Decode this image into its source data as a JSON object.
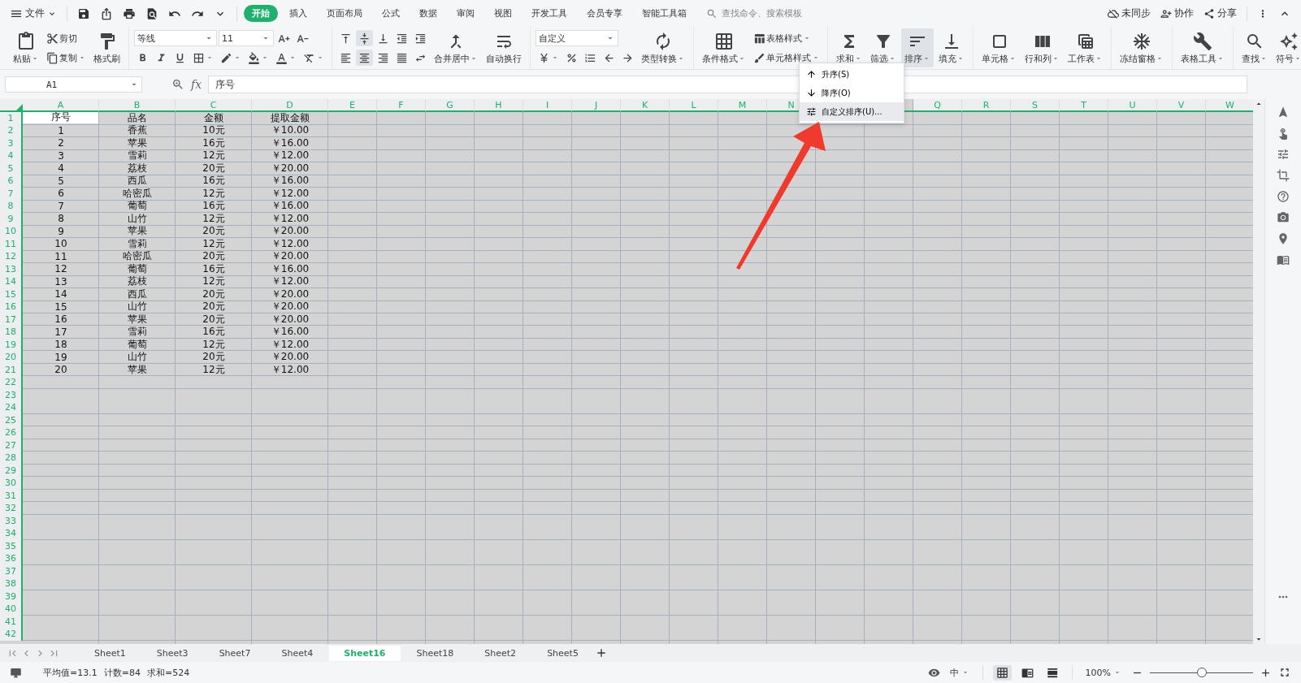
{
  "title_bar": {
    "file_menu": "文件",
    "menu_tabs": [
      {
        "label": "开始",
        "selected": true
      },
      {
        "label": "插入",
        "selected": false
      },
      {
        "label": "页面布局",
        "selected": false
      },
      {
        "label": "公式",
        "selected": false
      },
      {
        "label": "数据",
        "selected": false
      },
      {
        "label": "审阅",
        "selected": false
      },
      {
        "label": "视图",
        "selected": false
      },
      {
        "label": "开发工具",
        "selected": false
      },
      {
        "label": "会员专享",
        "selected": false
      },
      {
        "label": "智能工具箱",
        "selected": false
      }
    ],
    "search": {
      "placeholder": "查找命令、搜索模板"
    },
    "actions": [
      "未同步",
      "协作",
      "分享"
    ]
  },
  "ribbon": {
    "groups": [
      {
        "blocks": [
          {
            "kind": "large",
            "label": "粘贴",
            "dropdown": true
          },
          {
            "kind": "stack",
            "rows": [
              [
                {
                  "kind": "small",
                  "label": "剪切",
                  "dropdown": false
                }
              ],
              [
                {
                  "kind": "small",
                  "label": "复制",
                  "dropdown": true
                }
              ]
            ]
          },
          {
            "kind": "large",
            "label": "格式刷",
            "dropdown": false
          }
        ]
      },
      {
        "blocks": [
          {
            "kind": "stack",
            "rows": [
              [
                {
                  "kind": "select",
                  "label": "等线",
                  "wide": true
                },
                {
                  "kind": "select",
                  "label": "11",
                  "wide": false
                },
                {
                  "kind": "icon",
                  "dropdown": false
                },
                {
                  "kind": "icon",
                  "dropdown": false
                }
              ],
              [
                {
                  "kind": "icon",
                  "dropdown": false
                },
                {
                  "kind": "icon",
                  "dropdown": false
                },
                {
                  "kind": "icon",
                  "dropdown": false
                },
                {
                  "kind": "icon",
                  "dropdown": true
                },
                {
                  "kind": "icon",
                  "dropdown": true
                },
                {
                  "kind": "icon",
                  "dropdown": true
                },
                {
                  "kind": "icon",
                  "dropdown": true
                },
                {
                  "kind": "icon",
                  "dropdown": true
                }
              ]
            ]
          }
        ]
      },
      {
        "blocks": [
          {
            "kind": "stack",
            "rows": [
              [
                {
                  "kind": "icon",
                  "pressed": false
                },
                {
                  "kind": "icon",
                  "pressed": true
                },
                {
                  "kind": "icon",
                  "pressed": false
                },
                {
                  "kind": "icon",
                  "pressed": false
                },
                {
                  "kind": "icon",
                  "pressed": false
                }
              ],
              [
                {
                  "kind": "icon",
                  "pressed": false
                },
                {
                  "kind": "icon",
                  "pressed": true
                },
                {
                  "kind": "icon",
                  "pressed": false
                },
                {
                  "kind": "icon",
                  "pressed": false
                },
                {
                  "kind": "icon",
                  "pressed": false
                }
              ]
            ]
          },
          {
            "kind": "large",
            "label": "合并居中",
            "dropdown": true
          },
          {
            "kind": "large",
            "label": "自动换行",
            "dropdown": false
          }
        ]
      },
      {
        "blocks": [
          {
            "kind": "stack",
            "rows": [
              [
                {
                  "kind": "select",
                  "label": "自定义",
                  "wide": true
                }
              ],
              [
                {
                  "kind": "icon",
                  "dropdown": true
                },
                {
                  "kind": "icon",
                  "dropdown": false
                },
                {
                  "kind": "icon",
                  "dropdown": false
                },
                {
                  "kind": "icon",
                  "dropdown": false
                },
                {
                  "kind": "icon",
                  "dropdown": false
                }
              ]
            ]
          },
          {
            "kind": "large",
            "label": "类型转换",
            "dropdown": true
          }
        ]
      },
      {
        "blocks": [
          {
            "kind": "large",
            "label": "条件格式",
            "dropdown": true
          },
          {
            "kind": "stack",
            "rows": [
              [
                {
                  "kind": "small",
                  "label": "表格样式",
                  "dropdown": true
                }
              ],
              [
                {
                  "kind": "small",
                  "label": "单元格样式",
                  "dropdown": true
                }
              ]
            ]
          }
        ]
      },
      {
        "blocks": [
          {
            "kind": "large",
            "label": "求和",
            "dropdown": true
          },
          {
            "kind": "large",
            "label": "筛选",
            "dropdown": true
          },
          {
            "kind": "large",
            "label": "排序",
            "dropdown": true,
            "pressed": true
          },
          {
            "kind": "large",
            "label": "填充",
            "dropdown": true
          }
        ]
      },
      {
        "blocks": [
          {
            "kind": "large",
            "label": "单元格",
            "dropdown": true
          },
          {
            "kind": "large",
            "label": "行和列",
            "dropdown": true
          },
          {
            "kind": "large",
            "label": "工作表",
            "dropdown": true
          }
        ]
      },
      {
        "blocks": [
          {
            "kind": "large",
            "label": "冻结窗格",
            "dropdown": true
          }
        ]
      },
      {
        "blocks": [
          {
            "kind": "large",
            "label": "表格工具",
            "dropdown": true
          }
        ]
      },
      {
        "blocks": [
          {
            "kind": "large",
            "label": "查找",
            "dropdown": true
          },
          {
            "kind": "large",
            "label": "符号",
            "dropdown": true
          }
        ]
      }
    ]
  },
  "sort_menu": {
    "items": [
      {
        "label": "升序(S)",
        "highlighted": false
      },
      {
        "label": "降序(O)",
        "highlighted": false
      },
      {
        "label": "自定义排序(U)...",
        "highlighted": true
      }
    ]
  },
  "formula_bar": {
    "name_box": "A1",
    "fx": "fx",
    "value": "序号"
  },
  "sheet": {
    "range_selected": true,
    "columns": [
      {
        "label": "A"
      },
      {
        "label": "B"
      },
      {
        "label": "C"
      },
      {
        "label": "D"
      },
      {
        "label": "E"
      },
      {
        "label": "F"
      },
      {
        "label": "G"
      },
      {
        "label": "H"
      },
      {
        "label": "I"
      },
      {
        "label": "J"
      },
      {
        "label": "K"
      },
      {
        "label": "L"
      },
      {
        "label": "M"
      },
      {
        "label": "N"
      },
      null,
      null,
      {
        "label": "Q"
      },
      {
        "label": "R"
      },
      {
        "label": "S"
      },
      {
        "label": "T"
      },
      {
        "label": "U"
      },
      {
        "label": "V"
      },
      {
        "label": "W"
      }
    ],
    "row_numbers": [
      "1",
      "2",
      "3",
      "4",
      "5",
      "6",
      "7",
      "8",
      "9",
      "10",
      "11",
      "12",
      "13",
      "14",
      "15",
      "16",
      "17",
      "18",
      "19",
      "20",
      "21",
      "22",
      "23",
      "24",
      "25",
      "26",
      "27",
      "28",
      "29",
      "30",
      "31",
      "32",
      "33",
      "34",
      "35",
      "36",
      "37",
      "38",
      "39",
      "40",
      "41",
      "42"
    ],
    "rows": [
      [
        "序号",
        "品名",
        "金额",
        "提取金额"
      ],
      [
        "1",
        "香蕉",
        "10元",
        "￥10.00"
      ],
      [
        "2",
        "苹果",
        "16元",
        "￥16.00"
      ],
      [
        "3",
        "雪莉",
        "12元",
        "￥12.00"
      ],
      [
        "4",
        "荔枝",
        "20元",
        "￥20.00"
      ],
      [
        "5",
        "西瓜",
        "16元",
        "￥16.00"
      ],
      [
        "6",
        "哈密瓜",
        "12元",
        "￥12.00"
      ],
      [
        "7",
        "葡萄",
        "16元",
        "￥16.00"
      ],
      [
        "8",
        "山竹",
        "12元",
        "￥12.00"
      ],
      [
        "9",
        "苹果",
        "20元",
        "￥20.00"
      ],
      [
        "10",
        "雪莉",
        "12元",
        "￥12.00"
      ],
      [
        "11",
        "哈密瓜",
        "20元",
        "￥20.00"
      ],
      [
        "12",
        "葡萄",
        "16元",
        "￥16.00"
      ],
      [
        "13",
        "荔枝",
        "12元",
        "￥12.00"
      ],
      [
        "14",
        "西瓜",
        "20元",
        "￥20.00"
      ],
      [
        "15",
        "山竹",
        "20元",
        "￥20.00"
      ],
      [
        "16",
        "苹果",
        "20元",
        "￥20.00"
      ],
      [
        "17",
        "雪莉",
        "16元",
        "￥16.00"
      ],
      [
        "18",
        "葡萄",
        "12元",
        "￥12.00"
      ],
      [
        "19",
        "山竹",
        "20元",
        "￥20.00"
      ],
      [
        "20",
        "苹果",
        "12元",
        "￥12.00"
      ]
    ]
  },
  "sheet_tabs": [
    {
      "label": "Sheet1",
      "selected": false
    },
    {
      "label": "Sheet3",
      "selected": false
    },
    {
      "label": "Sheet7",
      "selected": false
    },
    {
      "label": "Sheet4",
      "selected": false
    },
    {
      "label": "Sheet16",
      "selected": true
    },
    {
      "label": "Sheet18",
      "selected": false
    },
    {
      "label": "Sheet2",
      "selected": false
    },
    {
      "label": "Sheet5",
      "selected": false
    }
  ],
  "status_bar": {
    "stats": [
      "平均值=13.1",
      "计数=84",
      "求和=524"
    ],
    "input_method": "中",
    "zoom": "100%",
    "zoom_slider": {
      "level": 0.5
    }
  }
}
